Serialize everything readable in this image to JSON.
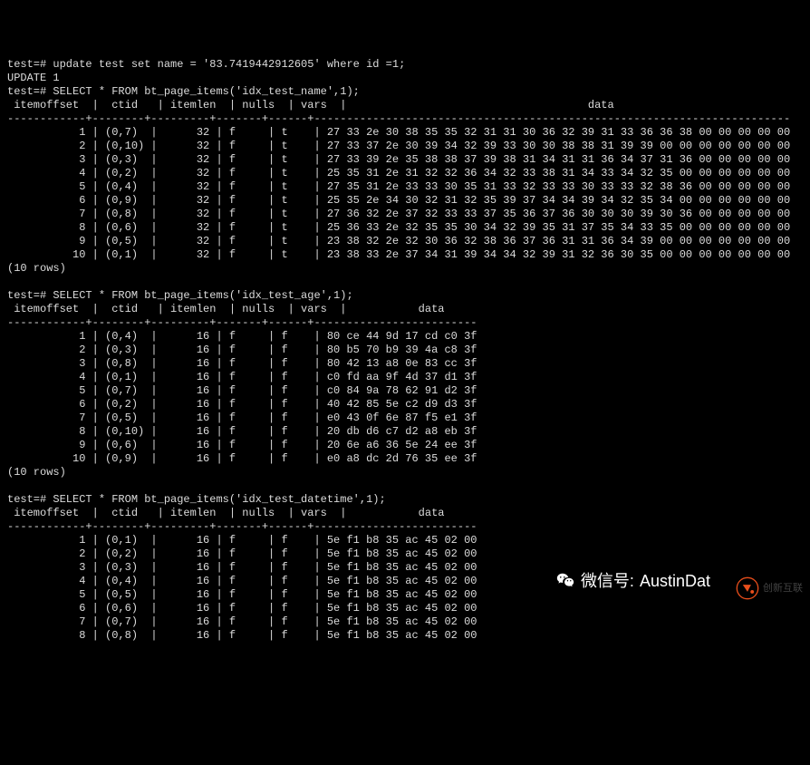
{
  "prompt": "test=#",
  "commands": {
    "update_cmd": "update test set name = '83.7419442912605' where id =1;",
    "update_result": "UPDATE 1",
    "select1": "SELECT * FROM bt_page_items('idx_test_name',1);",
    "select2": "SELECT * FROM bt_page_items('idx_test_age',1);",
    "select3": "SELECT * FROM bt_page_items('idx_test_datetime',1);"
  },
  "rows_msg": "(10 rows)",
  "table1": {
    "headers": [
      "itemoffset",
      "ctid",
      "itemlen",
      "nulls",
      "vars",
      "data"
    ],
    "rows": [
      {
        "itemoffset": "1",
        "ctid": "(0,7)",
        "itemlen": "32",
        "nulls": "f",
        "vars": "t",
        "data": "27 33 2e 30 38 35 35 32 31 31 30 36 32 39 31 33 36 36 38 00 00 00 00 00"
      },
      {
        "itemoffset": "2",
        "ctid": "(0,10)",
        "itemlen": "32",
        "nulls": "f",
        "vars": "t",
        "data": "27 33 37 2e 30 39 34 32 39 33 30 30 38 38 31 39 39 00 00 00 00 00 00 00"
      },
      {
        "itemoffset": "3",
        "ctid": "(0,3)",
        "itemlen": "32",
        "nulls": "f",
        "vars": "t",
        "data": "27 33 39 2e 35 38 38 37 39 38 31 34 31 31 36 34 37 31 36 00 00 00 00 00"
      },
      {
        "itemoffset": "4",
        "ctid": "(0,2)",
        "itemlen": "32",
        "nulls": "f",
        "vars": "t",
        "data": "25 35 31 2e 31 32 32 36 34 32 33 38 31 34 33 34 32 35 00 00 00 00 00 00"
      },
      {
        "itemoffset": "5",
        "ctid": "(0,4)",
        "itemlen": "32",
        "nulls": "f",
        "vars": "t",
        "data": "27 35 31 2e 33 33 30 35 31 33 32 33 33 30 33 33 32 38 36 00 00 00 00 00"
      },
      {
        "itemoffset": "6",
        "ctid": "(0,9)",
        "itemlen": "32",
        "nulls": "f",
        "vars": "t",
        "data": "25 35 2e 34 30 32 31 32 35 39 37 34 34 39 34 32 35 34 00 00 00 00 00 00"
      },
      {
        "itemoffset": "7",
        "ctid": "(0,8)",
        "itemlen": "32",
        "nulls": "f",
        "vars": "t",
        "data": "27 36 32 2e 37 32 33 33 37 35 36 37 36 30 30 30 39 30 36 00 00 00 00 00"
      },
      {
        "itemoffset": "8",
        "ctid": "(0,6)",
        "itemlen": "32",
        "nulls": "f",
        "vars": "t",
        "data": "25 36 33 2e 32 35 35 30 34 32 39 35 31 37 35 34 33 35 00 00 00 00 00 00"
      },
      {
        "itemoffset": "9",
        "ctid": "(0,5)",
        "itemlen": "32",
        "nulls": "f",
        "vars": "t",
        "data": "23 38 32 2e 32 30 36 32 38 36 37 36 31 31 36 34 39 00 00 00 00 00 00 00"
      },
      {
        "itemoffset": "10",
        "ctid": "(0,1)",
        "itemlen": "32",
        "nulls": "f",
        "vars": "t",
        "data": "23 38 33 2e 37 34 31 39 34 34 32 39 31 32 36 30 35 00 00 00 00 00 00 00"
      }
    ]
  },
  "table2": {
    "headers": [
      "itemoffset",
      "ctid",
      "itemlen",
      "nulls",
      "vars",
      "data"
    ],
    "rows": [
      {
        "itemoffset": "1",
        "ctid": "(0,4)",
        "itemlen": "16",
        "nulls": "f",
        "vars": "f",
        "data": "80 ce 44 9d 17 cd c0 3f"
      },
      {
        "itemoffset": "2",
        "ctid": "(0,3)",
        "itemlen": "16",
        "nulls": "f",
        "vars": "f",
        "data": "80 b5 70 b9 39 4a c8 3f"
      },
      {
        "itemoffset": "3",
        "ctid": "(0,8)",
        "itemlen": "16",
        "nulls": "f",
        "vars": "f",
        "data": "80 42 13 a8 0e 83 cc 3f"
      },
      {
        "itemoffset": "4",
        "ctid": "(0,1)",
        "itemlen": "16",
        "nulls": "f",
        "vars": "f",
        "data": "c0 fd aa 9f 4d 37 d1 3f"
      },
      {
        "itemoffset": "5",
        "ctid": "(0,7)",
        "itemlen": "16",
        "nulls": "f",
        "vars": "f",
        "data": "c0 84 9a 78 62 91 d2 3f"
      },
      {
        "itemoffset": "6",
        "ctid": "(0,2)",
        "itemlen": "16",
        "nulls": "f",
        "vars": "f",
        "data": "40 42 85 5e c2 d9 d3 3f"
      },
      {
        "itemoffset": "7",
        "ctid": "(0,5)",
        "itemlen": "16",
        "nulls": "f",
        "vars": "f",
        "data": "e0 43 0f 6e 87 f5 e1 3f"
      },
      {
        "itemoffset": "8",
        "ctid": "(0,10)",
        "itemlen": "16",
        "nulls": "f",
        "vars": "f",
        "data": "20 db d6 c7 d2 a8 eb 3f"
      },
      {
        "itemoffset": "9",
        "ctid": "(0,6)",
        "itemlen": "16",
        "nulls": "f",
        "vars": "f",
        "data": "20 6e a6 36 5e 24 ee 3f"
      },
      {
        "itemoffset": "10",
        "ctid": "(0,9)",
        "itemlen": "16",
        "nulls": "f",
        "vars": "f",
        "data": "e0 a8 dc 2d 76 35 ee 3f"
      }
    ]
  },
  "table3": {
    "headers": [
      "itemoffset",
      "ctid",
      "itemlen",
      "nulls",
      "vars",
      "data"
    ],
    "rows": [
      {
        "itemoffset": "1",
        "ctid": "(0,1)",
        "itemlen": "16",
        "nulls": "f",
        "vars": "f",
        "data": "5e f1 b8 35 ac 45 02 00"
      },
      {
        "itemoffset": "2",
        "ctid": "(0,2)",
        "itemlen": "16",
        "nulls": "f",
        "vars": "f",
        "data": "5e f1 b8 35 ac 45 02 00"
      },
      {
        "itemoffset": "3",
        "ctid": "(0,3)",
        "itemlen": "16",
        "nulls": "f",
        "vars": "f",
        "data": "5e f1 b8 35 ac 45 02 00"
      },
      {
        "itemoffset": "4",
        "ctid": "(0,4)",
        "itemlen": "16",
        "nulls": "f",
        "vars": "f",
        "data": "5e f1 b8 35 ac 45 02 00"
      },
      {
        "itemoffset": "5",
        "ctid": "(0,5)",
        "itemlen": "16",
        "nulls": "f",
        "vars": "f",
        "data": "5e f1 b8 35 ac 45 02 00"
      },
      {
        "itemoffset": "6",
        "ctid": "(0,6)",
        "itemlen": "16",
        "nulls": "f",
        "vars": "f",
        "data": "5e f1 b8 35 ac 45 02 00"
      },
      {
        "itemoffset": "7",
        "ctid": "(0,7)",
        "itemlen": "16",
        "nulls": "f",
        "vars": "f",
        "data": "5e f1 b8 35 ac 45 02 00"
      },
      {
        "itemoffset": "8",
        "ctid": "(0,8)",
        "itemlen": "16",
        "nulls": "f",
        "vars": "f",
        "data": "5e f1 b8 35 ac 45 02 00"
      }
    ]
  },
  "watermark": {
    "label": "微信号:",
    "handle": "AustinDat"
  },
  "logo_text": "创新互联"
}
